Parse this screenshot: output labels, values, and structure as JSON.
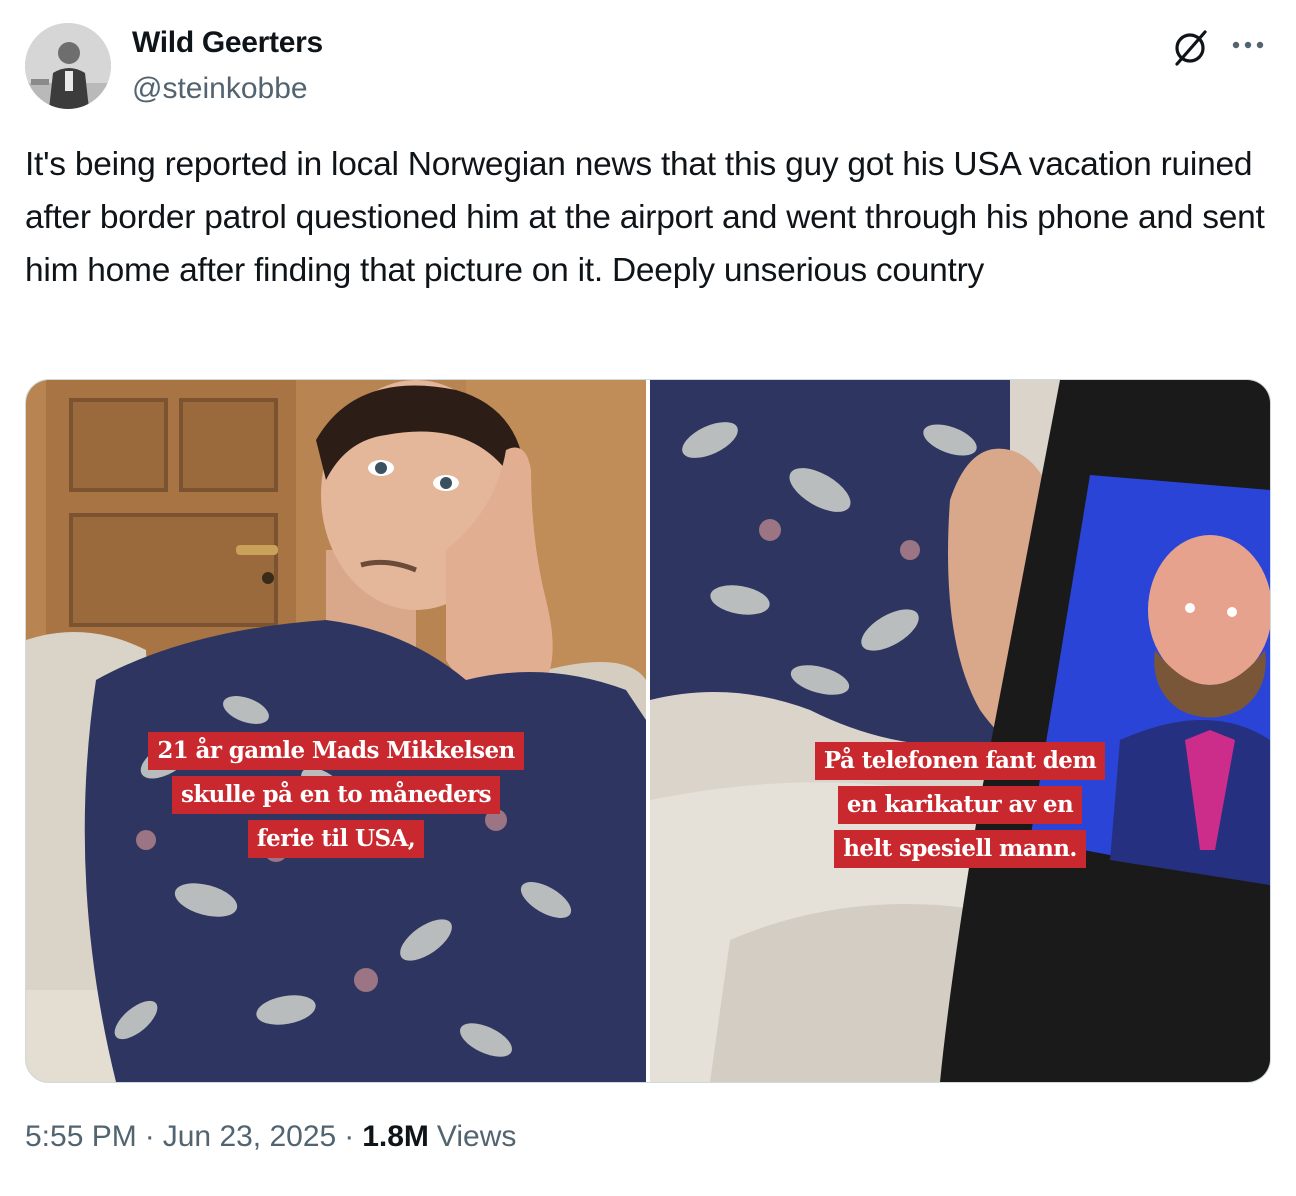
{
  "author": {
    "name": "Wild Geerters",
    "handle": "@steinkobbe",
    "avatar_icon": "user-avatar"
  },
  "icons": {
    "grok": "grok-icon",
    "more": "more-icon"
  },
  "tweet": {
    "text": "It's being reported in local Norwegian news that this guy got his USA vacation ruined after border patrol questioned him at the airport and went through his phone and sent him home after finding that picture on it. Deeply unserious country"
  },
  "media": {
    "left": {
      "caption": [
        "21 år gamle Mads Mikkelsen",
        "skulle på en to måneders",
        "ferie til USA,"
      ]
    },
    "right": {
      "caption": [
        "På telefonen fant dem",
        "en karikatur av en",
        "helt spesiell mann."
      ]
    }
  },
  "meta": {
    "time": "5:55 PM",
    "separator": "·",
    "date": "Jun 23, 2025",
    "views_count": "1.8M",
    "views_label": "Views"
  },
  "colors": {
    "text": "#0f1419",
    "secondary": "#536471",
    "caption_bg": "#c8282e",
    "border": "#cfd9de"
  }
}
